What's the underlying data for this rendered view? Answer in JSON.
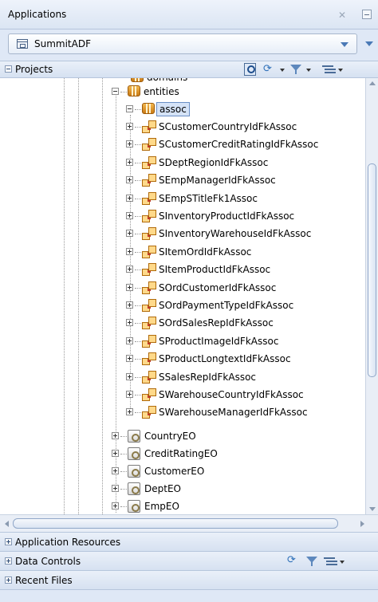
{
  "panel": {
    "title": "Applications"
  },
  "application_selector": {
    "value": "SummitADF"
  },
  "projects": {
    "title": "Projects"
  },
  "tree": {
    "partial_top_label": "domains",
    "entities_label": "entities",
    "assoc_label": "assoc",
    "assoc_items": [
      "SCustomerCountryIdFkAssoc",
      "SCustomerCreditRatingIdFkAssoc",
      "SDeptRegionIdFkAssoc",
      "SEmpManagerIdFkAssoc",
      "SEmpSTitleFk1Assoc",
      "SInventoryProductIdFkAssoc",
      "SInventoryWarehouseIdFkAssoc",
      "SItemOrdIdFkAssoc",
      "SItemProductIdFkAssoc",
      "SOrdCustomerIdFkAssoc",
      "SOrdPaymentTypeIdFkAssoc",
      "SOrdSalesRepIdFkAssoc",
      "SProductImageIdFkAssoc",
      "SProductLongtextIdFkAssoc",
      "SSalesRepIdFkAssoc",
      "SWarehouseCountryIdFkAssoc",
      "SWarehouseManagerIdFkAssoc"
    ],
    "entity_objects": [
      "CountryEO",
      "CreditRatingEO",
      "CustomerEO",
      "DeptEO",
      "EmpEO"
    ]
  },
  "sections": {
    "application_resources": "Application Resources",
    "data_controls": "Data Controls",
    "recent_files": "Recent Files"
  },
  "icons": {
    "package": "package-icon",
    "association": "association-icon",
    "entity_object": "entity-object-icon"
  }
}
